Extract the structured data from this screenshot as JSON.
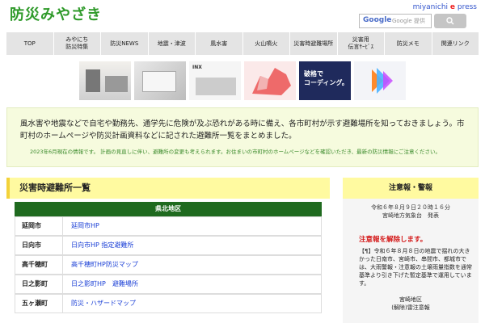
{
  "header": {
    "logo": "防災みやざき",
    "brand_prefix": "miyanichi ",
    "brand_e": "e",
    "brand_suffix": " press",
    "search_placeholder": "Google 提供",
    "search_logo": "Google"
  },
  "nav": [
    "TOP",
    "みやにち\n防災特集",
    "防災NEWS",
    "地震・津波",
    "風水害",
    "火山噴火",
    "災害時避難場所",
    "災害用\n伝言ｻｰﾋﾞｽ",
    "防災メモ",
    "関連リンク"
  ],
  "ads": {
    "ad3_text": "INX",
    "ad5_text": "破格で\nコーディング。"
  },
  "notice": {
    "p1": "風水害や地震などで自宅や勤務先、通学先に危険が及ぶ恐れがある時に備え、各市町村が示す避難場所を知っておきましょう。市町村のホームページや防災計画資料などに記された避難所一覧をまとめました。",
    "p2": "2023年6月現在の情報です。 計画の見直しに伴い、避難所の変更も考えられます。お住まいの市町村のホームページなどを確認いただき、最新の防災情報にご注意ください。"
  },
  "left": {
    "title": "災害時避難所一覧",
    "region": "県北地区",
    "rows": [
      {
        "city": "延岡市",
        "links": "延岡市HP"
      },
      {
        "city": "日向市",
        "links": "日向市HP 指定避難所"
      },
      {
        "city": "高千穂町",
        "links": "高千穂町HP防災マップ"
      },
      {
        "city": "日之影町",
        "links": "日之影町HP　避難場所"
      },
      {
        "city": "五ヶ瀬町",
        "links": "防災・ハザードマップ"
      }
    ]
  },
  "right": {
    "title": "注意報・警報",
    "date": "令和６年８月９日２０時１６分\n宮崎地方気象台　発表",
    "alert": "注意報を解除します。",
    "body": "【¶】令和６年８月８日の地震で揺れの大きかった日南市、宮崎市、串間市、都城市では、大雨警報・注意報の土壌雨量指数を通常基準より引き下げた暫定基準で運用しています。",
    "foot": "宮崎地区\n(解除)雷注意報"
  }
}
